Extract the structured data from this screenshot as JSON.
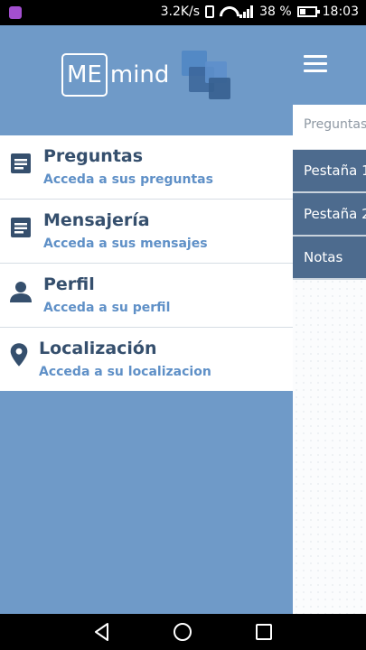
{
  "status_bar": {
    "speed": "3.2K/s",
    "battery": "38 %",
    "time": "18:03",
    "battery_fraction": 0.38
  },
  "drawer": {
    "logo": {
      "me": "ME",
      "mind": "mind"
    },
    "items": [
      {
        "title": "Preguntas",
        "subtitle": "Acceda a sus preguntas",
        "icon": "document-icon"
      },
      {
        "title": "Mensajería",
        "subtitle": "Acceda a sus mensajes",
        "icon": "document-icon"
      },
      {
        "title": "Perfil",
        "subtitle": "Acceda a su perfil",
        "icon": "person-icon"
      },
      {
        "title": "Localización",
        "subtitle": "Acceda a su localizacion",
        "icon": "location-pin-icon"
      }
    ]
  },
  "main": {
    "search_placeholder": "Preguntas",
    "tabs": [
      "Pestaña 1",
      "Pestaña 2",
      "Notas"
    ]
  },
  "colors": {
    "drawer_bg": "#6f9ac8",
    "title": "#354f6d",
    "subtitle": "#5f90c7",
    "tab_bg": "#4d6b8e"
  }
}
